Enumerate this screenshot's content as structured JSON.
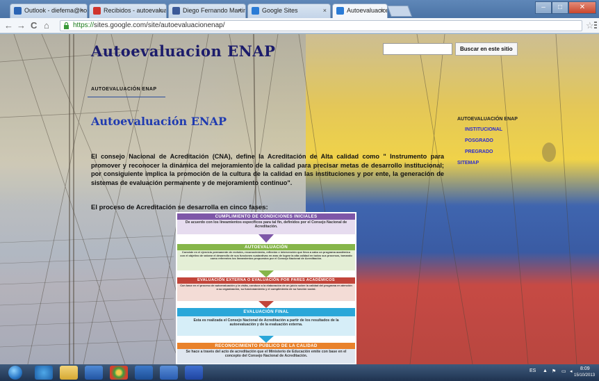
{
  "browser": {
    "tabs": [
      {
        "label": "Outlook - diefema@hotm",
        "favicon_color": "#2a64b5"
      },
      {
        "label": "Recibidos - autoevaluacio",
        "favicon_color": "#d0342c"
      },
      {
        "label": "Diego Fernando Martinez",
        "favicon_color": "#3b5998"
      },
      {
        "label": "Google Sites",
        "favicon_color": "#2a7bd6"
      },
      {
        "label": "Autoevaluacion ENAP",
        "favicon_color": "#2a7bd6"
      }
    ],
    "tab_close": "×",
    "back": "←",
    "forward": "→",
    "reload": "C",
    "home": "⌂",
    "url_scheme": "https://",
    "url_rest": "sites.google.com/site/autoevaluacionenap/",
    "star": "☆"
  },
  "site": {
    "title": "Autoevaluacion ENAP",
    "search_placeholder": "",
    "search_button": "Buscar en este sitio",
    "nav_label": "AUTOEVALUACIÓN ENAP",
    "page_heading": "Autoevaluación ENAP",
    "paragraph": "El consejo Nacional de Acreditación (CNA), define la Acreditación de Alta calidad como \" Instrumento para promover y reconocer la dinámica del mejoramiento de la calidad para precisar metas de desarrollo institucional; por consiguiente implica la promoción de la cultura de la calidad en las instituciones y por ente, la generación de sistemas de evaluación permanente y de mejoramiento continuo\".",
    "phases_intro": "El proceso de Acreditación se desarrolla en  cinco fases:"
  },
  "sidebar": {
    "title": "AUTOEVALUACIÓN ENAP",
    "items": [
      "INSTITUCIONAL",
      "POSGRADO",
      "PREGRADO"
    ],
    "sitemap": "SITEMAP"
  },
  "diagram": {
    "phases": [
      {
        "title": "CUMPLIMIENTO DE CONDICIONES INICIALES",
        "text": "De acuerdo con los lineamientos  específicos para tal fin, definidos por el Consejo Nacional de Acreditación.",
        "color": "#7e57a8",
        "bg": "#e6dcef"
      },
      {
        "title": "AUTOEVALUACIÓN",
        "text": "Consiste en el ejercicio permanente de revisión, reconocimiento, reflexión e intervención que lleva a cabo un programa académico con el objetivo de valorar el desarrollo de sus funciones sustantivas en aras de lograr la alta calidad en todos sus procesos, tomando como referentes los lineamientos propuestos por el Consejo Nacional de Acreditación.",
        "color": "#86b64a",
        "bg": "#e4efd6"
      },
      {
        "title": "EVALUACIÓN EXTERNA O EVALUACIÓN POR PARES ACADÉMICOS",
        "text": "Con base en el proceso de autoevaluación y la visita, conduce a la elaboración de un juicio sobre la calidad del programa en atención a su organización, su funcionamiento y el cumplimiento de su función social.",
        "color": "#c2453a",
        "bg": "#f3dcd6"
      },
      {
        "title": "EVALUACIÓN  FINAL",
        "text": "Esta es realizada  el Consejo Nacional de Acreditación a partir de los resultados de la autoevaluación y de la evaluación externa.",
        "color": "#2aa7d9",
        "bg": "#d6eef8"
      },
      {
        "title": "RECONOCIMIENTO PÚBLICO DE LA CALIDAD",
        "text": "Se hace a través del acto de  acreditación que el Ministerio de Educación emite con base en el concepto del Consejo Nacional de Acreditación.",
        "color": "#e9822b",
        "bg": "#dfe6ef"
      }
    ]
  },
  "taskbar": {
    "lang": "ES",
    "time": "8:09",
    "date": "15/10/2013"
  }
}
